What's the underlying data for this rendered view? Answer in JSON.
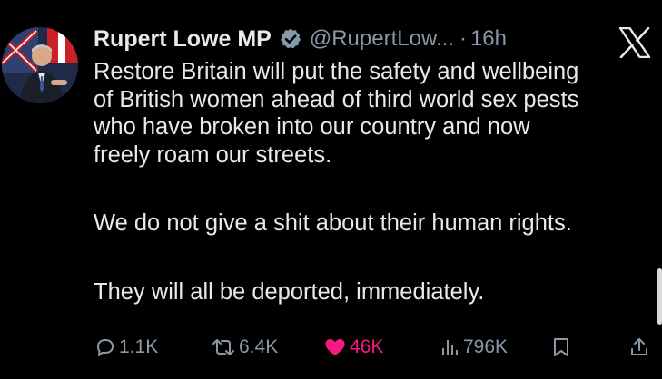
{
  "author": {
    "name": "Rupert Lowe MP",
    "handle": "@RupertLow...",
    "separator": "·",
    "time": "16h",
    "verified_icon": "verified-badge-icon"
  },
  "platform_logo": "x-logo-icon",
  "tweet": {
    "lines_p1": [
      "Restore Britain will put the safety and wellbeing",
      "of British women ahead of third world sex pests",
      "who have broken into our country and now",
      "freely roam our streets."
    ],
    "p2": "We do not give a shit about their human rights.",
    "p3": "They will all be deported, immediately."
  },
  "actions": {
    "replies": "1.1K",
    "retweets": "6.4K",
    "likes": "46K",
    "views": "796K"
  },
  "colors": {
    "background": "#000000",
    "text": "#e7e9ea",
    "secondary": "#8b98a5",
    "like": "#f91880",
    "verified": "#829aab"
  }
}
